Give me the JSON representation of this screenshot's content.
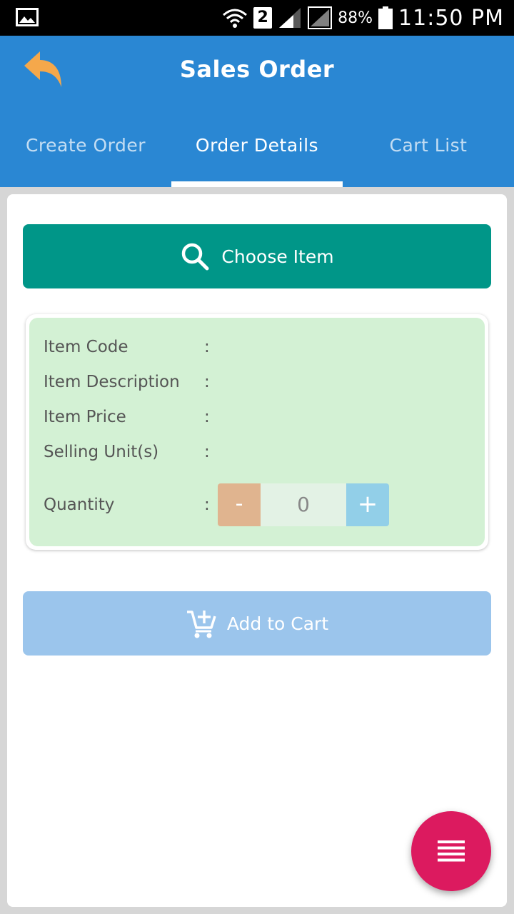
{
  "status_bar": {
    "sim_slot": "2",
    "battery": "88%",
    "time": "11:50 PM"
  },
  "header": {
    "title": "Sales Order"
  },
  "tabs": [
    {
      "label": "Create Order",
      "active": false
    },
    {
      "label": "Order Details",
      "active": true
    },
    {
      "label": "Cart List",
      "active": false
    }
  ],
  "choose_item": {
    "label": "Choose Item",
    "icon": "search-icon"
  },
  "details": {
    "fields": [
      {
        "label": "Item Code",
        "separator": ":"
      },
      {
        "label": "Item Description",
        "separator": ":"
      },
      {
        "label": "Item Price",
        "separator": ":"
      },
      {
        "label": "Selling Unit(s)",
        "separator": ":"
      }
    ],
    "quantity": {
      "label": "Quantity",
      "separator": ":",
      "minus": "-",
      "value": "0",
      "plus": "+"
    }
  },
  "add_to_cart": {
    "label": "Add to Cart",
    "icon": "add-cart-icon"
  },
  "colors": {
    "appbar": "#2a87d3",
    "choose_button": "#009688",
    "details_background": "#d3f1d4",
    "add_to_cart_button": "#9bc5ec",
    "fab": "#dc1a5f",
    "back_icon": "#f5a84b"
  },
  "fab": {
    "icon": "menu-lines-icon"
  }
}
